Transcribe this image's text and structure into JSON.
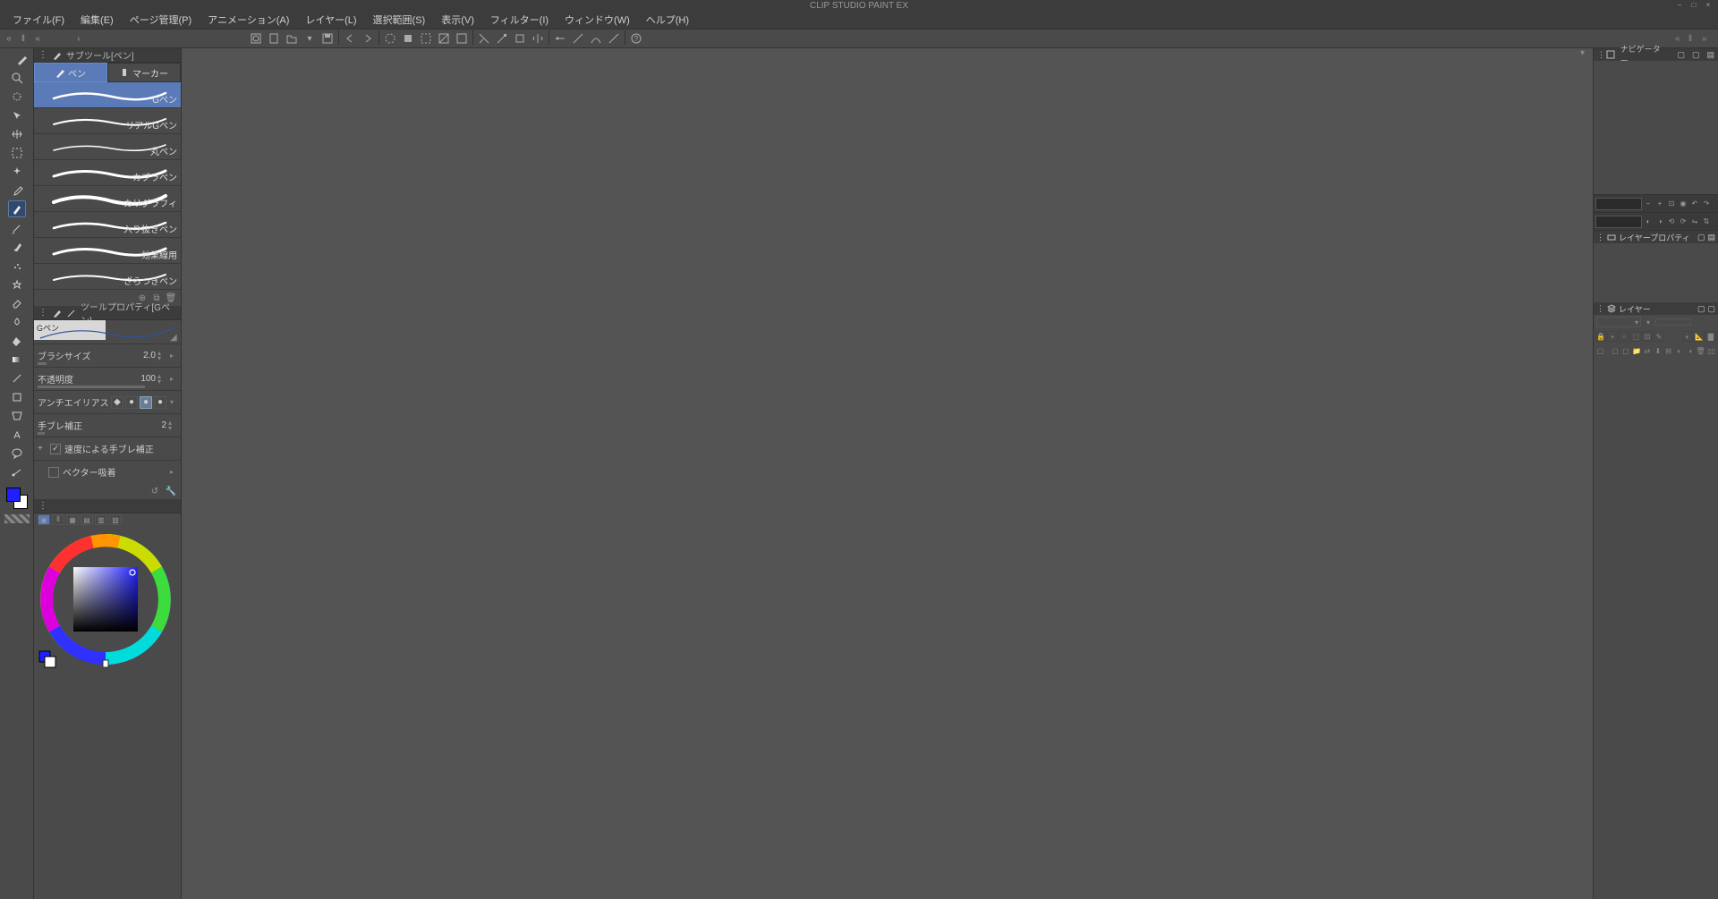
{
  "app_title": "CLIP STUDIO PAINT EX",
  "menu": [
    "ファイル(F)",
    "編集(E)",
    "ページ管理(P)",
    "アニメーション(A)",
    "レイヤー(L)",
    "選択範囲(S)",
    "表示(V)",
    "フィルター(I)",
    "ウィンドウ(W)",
    "ヘルプ(H)"
  ],
  "subtool_panel": {
    "title": "サブツール[ペン]",
    "tabs": {
      "pen": "ペン",
      "marker": "マーカー"
    },
    "items": [
      "Gペン",
      "リアルGペン",
      "丸ペン",
      "カブラペン",
      "カリグラフィ",
      "入り抜きペン",
      "効果線用",
      "ざらつきペン"
    ]
  },
  "toolprop": {
    "title": "ツールプロパティ[Gペン]",
    "preview_label": "Gペン",
    "brush_size": {
      "label": "ブラシサイズ",
      "value": "2.0"
    },
    "opacity": {
      "label": "不透明度",
      "value": "100"
    },
    "antialias": {
      "label": "アンチエイリアス"
    },
    "stabilize": {
      "label": "手ブレ補正",
      "value": "2"
    },
    "speed_stabilize": {
      "label": "速度による手ブレ補正"
    },
    "vector_snap": {
      "label": "ベクター吸着"
    }
  },
  "right": {
    "navigator": "ナビゲーター",
    "layer_property": "レイヤープロパティ",
    "layer": "レイヤー"
  },
  "colors": {
    "fg": "#2020ff",
    "bg": "#ffffff"
  }
}
